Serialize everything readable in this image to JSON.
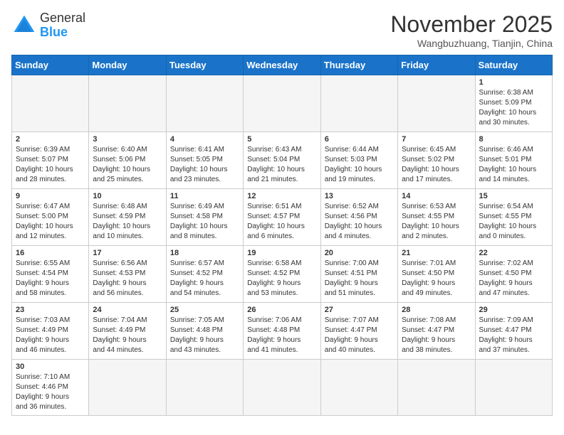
{
  "header": {
    "logo_general": "General",
    "logo_blue": "Blue",
    "month_title": "November 2025",
    "location": "Wangbuzhuang, Tianjin, China"
  },
  "weekdays": [
    "Sunday",
    "Monday",
    "Tuesday",
    "Wednesday",
    "Thursday",
    "Friday",
    "Saturday"
  ],
  "weeks": [
    [
      {
        "day": "",
        "info": ""
      },
      {
        "day": "",
        "info": ""
      },
      {
        "day": "",
        "info": ""
      },
      {
        "day": "",
        "info": ""
      },
      {
        "day": "",
        "info": ""
      },
      {
        "day": "",
        "info": ""
      },
      {
        "day": "1",
        "info": "Sunrise: 6:38 AM\nSunset: 5:09 PM\nDaylight: 10 hours\nand 30 minutes."
      }
    ],
    [
      {
        "day": "2",
        "info": "Sunrise: 6:39 AM\nSunset: 5:07 PM\nDaylight: 10 hours\nand 28 minutes."
      },
      {
        "day": "3",
        "info": "Sunrise: 6:40 AM\nSunset: 5:06 PM\nDaylight: 10 hours\nand 25 minutes."
      },
      {
        "day": "4",
        "info": "Sunrise: 6:41 AM\nSunset: 5:05 PM\nDaylight: 10 hours\nand 23 minutes."
      },
      {
        "day": "5",
        "info": "Sunrise: 6:43 AM\nSunset: 5:04 PM\nDaylight: 10 hours\nand 21 minutes."
      },
      {
        "day": "6",
        "info": "Sunrise: 6:44 AM\nSunset: 5:03 PM\nDaylight: 10 hours\nand 19 minutes."
      },
      {
        "day": "7",
        "info": "Sunrise: 6:45 AM\nSunset: 5:02 PM\nDaylight: 10 hours\nand 17 minutes."
      },
      {
        "day": "8",
        "info": "Sunrise: 6:46 AM\nSunset: 5:01 PM\nDaylight: 10 hours\nand 14 minutes."
      }
    ],
    [
      {
        "day": "9",
        "info": "Sunrise: 6:47 AM\nSunset: 5:00 PM\nDaylight: 10 hours\nand 12 minutes."
      },
      {
        "day": "10",
        "info": "Sunrise: 6:48 AM\nSunset: 4:59 PM\nDaylight: 10 hours\nand 10 minutes."
      },
      {
        "day": "11",
        "info": "Sunrise: 6:49 AM\nSunset: 4:58 PM\nDaylight: 10 hours\nand 8 minutes."
      },
      {
        "day": "12",
        "info": "Sunrise: 6:51 AM\nSunset: 4:57 PM\nDaylight: 10 hours\nand 6 minutes."
      },
      {
        "day": "13",
        "info": "Sunrise: 6:52 AM\nSunset: 4:56 PM\nDaylight: 10 hours\nand 4 minutes."
      },
      {
        "day": "14",
        "info": "Sunrise: 6:53 AM\nSunset: 4:55 PM\nDaylight: 10 hours\nand 2 minutes."
      },
      {
        "day": "15",
        "info": "Sunrise: 6:54 AM\nSunset: 4:55 PM\nDaylight: 10 hours\nand 0 minutes."
      }
    ],
    [
      {
        "day": "16",
        "info": "Sunrise: 6:55 AM\nSunset: 4:54 PM\nDaylight: 9 hours\nand 58 minutes."
      },
      {
        "day": "17",
        "info": "Sunrise: 6:56 AM\nSunset: 4:53 PM\nDaylight: 9 hours\nand 56 minutes."
      },
      {
        "day": "18",
        "info": "Sunrise: 6:57 AM\nSunset: 4:52 PM\nDaylight: 9 hours\nand 54 minutes."
      },
      {
        "day": "19",
        "info": "Sunrise: 6:58 AM\nSunset: 4:52 PM\nDaylight: 9 hours\nand 53 minutes."
      },
      {
        "day": "20",
        "info": "Sunrise: 7:00 AM\nSunset: 4:51 PM\nDaylight: 9 hours\nand 51 minutes."
      },
      {
        "day": "21",
        "info": "Sunrise: 7:01 AM\nSunset: 4:50 PM\nDaylight: 9 hours\nand 49 minutes."
      },
      {
        "day": "22",
        "info": "Sunrise: 7:02 AM\nSunset: 4:50 PM\nDaylight: 9 hours\nand 47 minutes."
      }
    ],
    [
      {
        "day": "23",
        "info": "Sunrise: 7:03 AM\nSunset: 4:49 PM\nDaylight: 9 hours\nand 46 minutes."
      },
      {
        "day": "24",
        "info": "Sunrise: 7:04 AM\nSunset: 4:49 PM\nDaylight: 9 hours\nand 44 minutes."
      },
      {
        "day": "25",
        "info": "Sunrise: 7:05 AM\nSunset: 4:48 PM\nDaylight: 9 hours\nand 43 minutes."
      },
      {
        "day": "26",
        "info": "Sunrise: 7:06 AM\nSunset: 4:48 PM\nDaylight: 9 hours\nand 41 minutes."
      },
      {
        "day": "27",
        "info": "Sunrise: 7:07 AM\nSunset: 4:47 PM\nDaylight: 9 hours\nand 40 minutes."
      },
      {
        "day": "28",
        "info": "Sunrise: 7:08 AM\nSunset: 4:47 PM\nDaylight: 9 hours\nand 38 minutes."
      },
      {
        "day": "29",
        "info": "Sunrise: 7:09 AM\nSunset: 4:47 PM\nDaylight: 9 hours\nand 37 minutes."
      }
    ],
    [
      {
        "day": "30",
        "info": "Sunrise: 7:10 AM\nSunset: 4:46 PM\nDaylight: 9 hours\nand 36 minutes."
      },
      {
        "day": "",
        "info": ""
      },
      {
        "day": "",
        "info": ""
      },
      {
        "day": "",
        "info": ""
      },
      {
        "day": "",
        "info": ""
      },
      {
        "day": "",
        "info": ""
      },
      {
        "day": "",
        "info": ""
      }
    ]
  ]
}
